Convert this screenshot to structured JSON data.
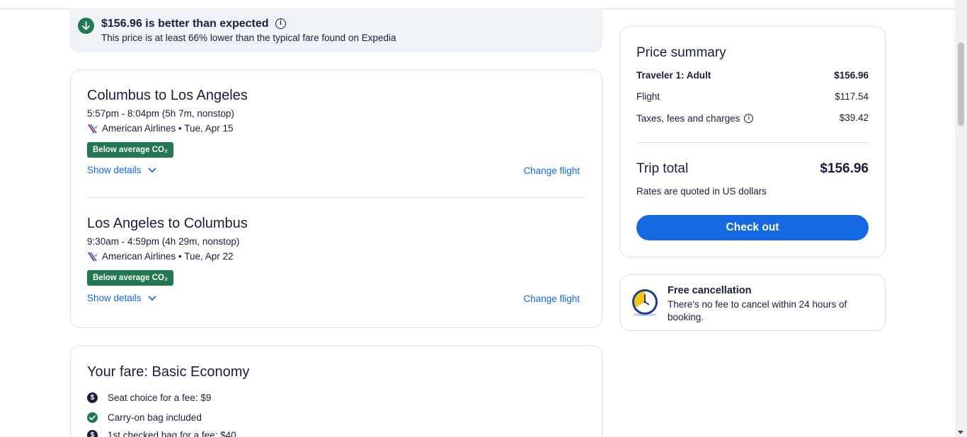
{
  "banner": {
    "title": "$156.96 is better than expected",
    "subtitle": "This price is at least 66% lower than the typical fare found on Expedia",
    "info_icon": "info-icon",
    "status_icon": "arrow-down-icon",
    "accent": "#227950"
  },
  "flights": [
    {
      "title": "Columbus to Los Angeles",
      "time": "5:57pm - 8:04pm (5h 7m, nonstop)",
      "airline": "American Airlines • Tue, Apr 15",
      "badge": "Below average CO₂",
      "show_details": "Show details",
      "change_flight": "Change flight"
    },
    {
      "title": "Los Angeles to Columbus",
      "time": "9:30am - 4:59pm (4h 29m, nonstop)",
      "airline": "American Airlines • Tue, Apr 22",
      "badge": "Below average CO₂",
      "show_details": "Show details",
      "change_flight": "Change flight"
    }
  ],
  "fare": {
    "title": "Your fare: Basic Economy",
    "items": [
      {
        "icon": "dollar-icon",
        "text": "Seat choice for a fee: $9"
      },
      {
        "icon": "check-icon",
        "text": "Carry-on bag included"
      },
      {
        "icon": "dollar-icon",
        "text": "1st checked bag for a fee: $40"
      }
    ]
  },
  "summary": {
    "title": "Price summary",
    "traveler_label": "Traveler 1: Adult",
    "traveler_value": "$156.96",
    "flight_label": "Flight",
    "flight_value": "$117.54",
    "taxes_label": "Taxes, fees and charges",
    "taxes_value": "$39.42",
    "trip_total_label": "Trip total",
    "trip_total_value": "$156.96",
    "rates_note": "Rates are quoted in US dollars",
    "checkout_label": "Check out",
    "button_color": "#1668e3"
  },
  "cancellation": {
    "title": "Free cancellation",
    "text": "There's no fee to cancel within 24 hours of booking.",
    "icon": "clock-icon"
  }
}
